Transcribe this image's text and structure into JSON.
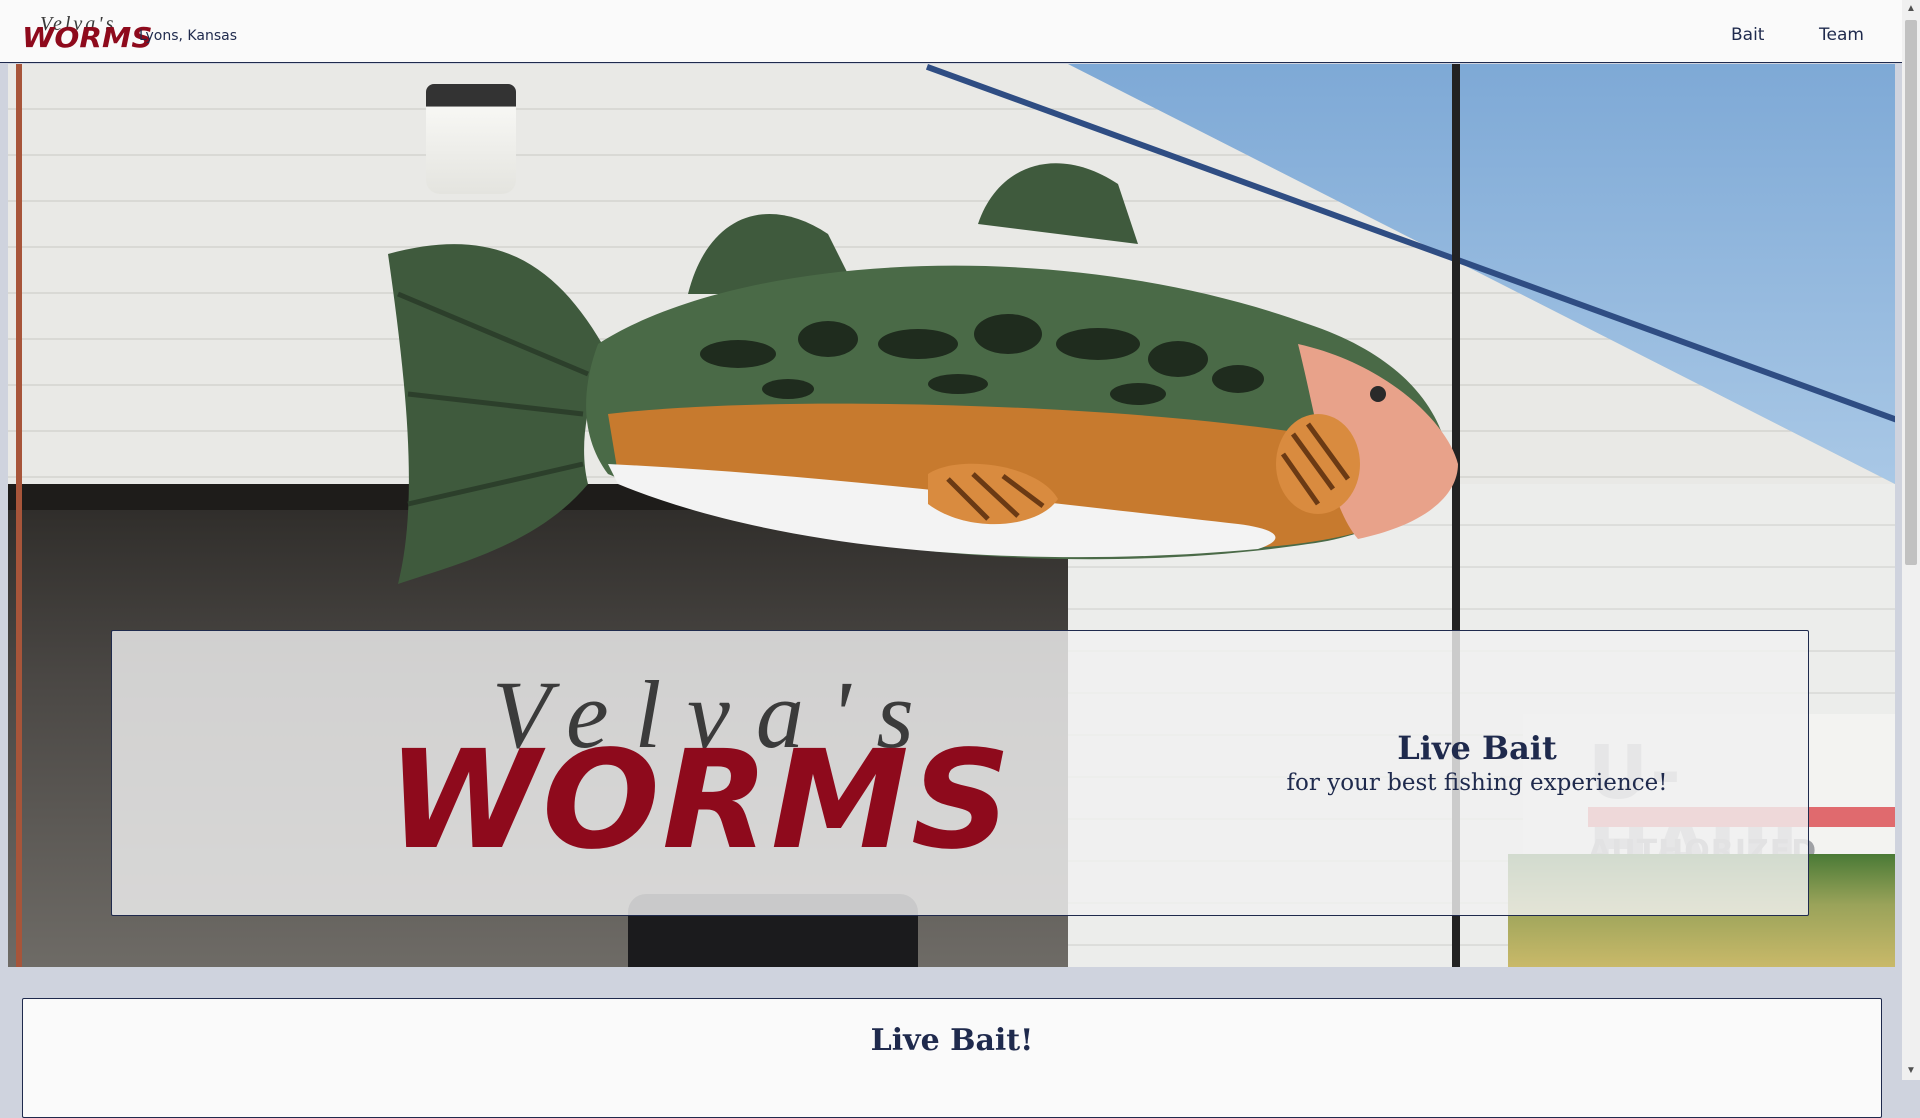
{
  "navbar": {
    "brand_top": "Velva's",
    "brand_bottom": "WORMS",
    "location": "Lyons, Kansas",
    "links": [
      {
        "label": "Bait"
      },
      {
        "label": "Team"
      }
    ]
  },
  "hero": {
    "logo_top": "Velva's",
    "logo_bottom": "WORMS",
    "tagline_title": "Live Bait",
    "tagline_sub": "for your best fishing experience!",
    "sign_brand": "U-HAUL",
    "sign_sub": "AUTHORIZED DEALER"
  },
  "content": {
    "section_title": "Live Bait!"
  },
  "colors": {
    "brand_red": "#8e0a1c",
    "navy": "#1f2a4d",
    "page_bg": "#cfd3de"
  }
}
